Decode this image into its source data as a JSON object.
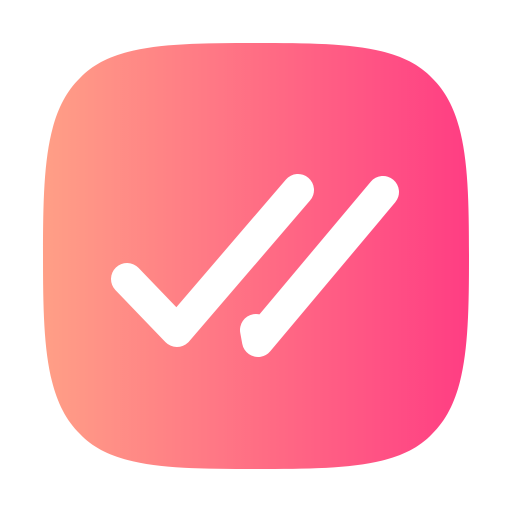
{
  "icon": {
    "name": "double-check-icon",
    "gradient_start": "#FF9F86",
    "gradient_end": "#FF3D83",
    "glyph_color": "#FFFFFF"
  }
}
